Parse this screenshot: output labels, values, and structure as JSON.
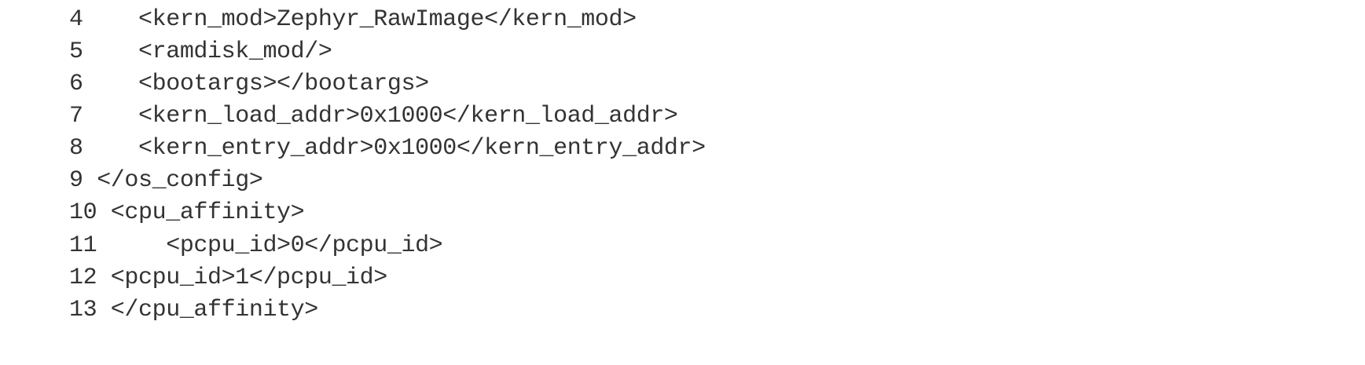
{
  "code": {
    "lines": [
      "4    <kern_mod>Zephyr_RawImage</kern_mod>",
      "5    <ramdisk_mod/>",
      "6    <bootargs></bootargs>",
      "7    <kern_load_addr>0x1000</kern_load_addr>",
      "8    <kern_entry_addr>0x1000</kern_entry_addr>",
      "9 </os_config>",
      "10 <cpu_affinity>",
      "11     <pcpu_id>0</pcpu_id>",
      "12 <pcpu_id>1</pcpu_id>",
      "13 </cpu_affinity>"
    ]
  }
}
